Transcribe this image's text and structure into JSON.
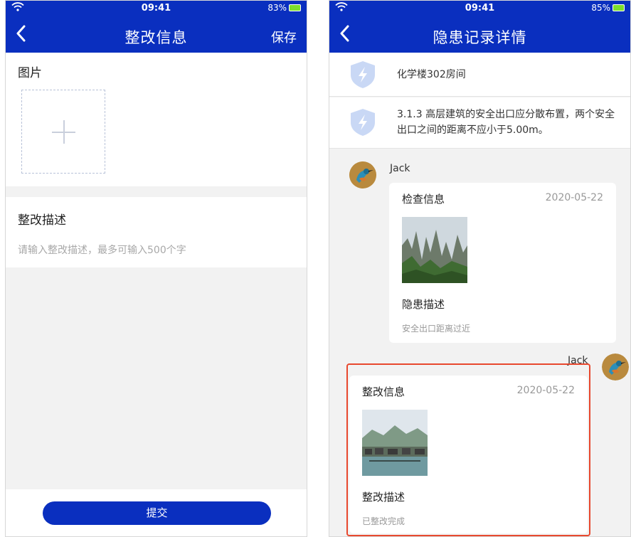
{
  "left": {
    "status": {
      "time": "09:41",
      "battery": "83%"
    },
    "nav": {
      "back_icon": "‹",
      "title": "整改信息",
      "action": "保存"
    },
    "photo_section": {
      "title": "图片"
    },
    "desc_section": {
      "title": "整改描述",
      "placeholder": "请输入整改描述，最多可输入500个字"
    },
    "submit_label": "提交"
  },
  "right": {
    "status": {
      "time": "09:41",
      "battery": "85%"
    },
    "nav": {
      "back_icon": "‹",
      "title": "隐患记录详情"
    },
    "location": "化学楼302房间",
    "regulation": "3.1.3 高层建筑的安全出口应分散布置，两个安全出口之间的距离不应小于5.00m。",
    "inspection": {
      "user": "Jack",
      "title": "检查信息",
      "date": "2020-05-22",
      "sub_title": "隐患描述",
      "note": "安全出口距离过近"
    },
    "rectification": {
      "user": "Jack",
      "title": "整改信息",
      "date": "2020-05-22",
      "sub_title": "整改描述",
      "note": "已整改完成"
    }
  },
  "colors": {
    "brand": "#0a2fbf",
    "highlight": "#e8482e",
    "shield": "#c9d8f5"
  },
  "icons": [
    "wifi-icon",
    "battery-icon",
    "back-arrow-icon",
    "plus-icon",
    "shield-bolt-icon",
    "avatar-bird-icon"
  ]
}
